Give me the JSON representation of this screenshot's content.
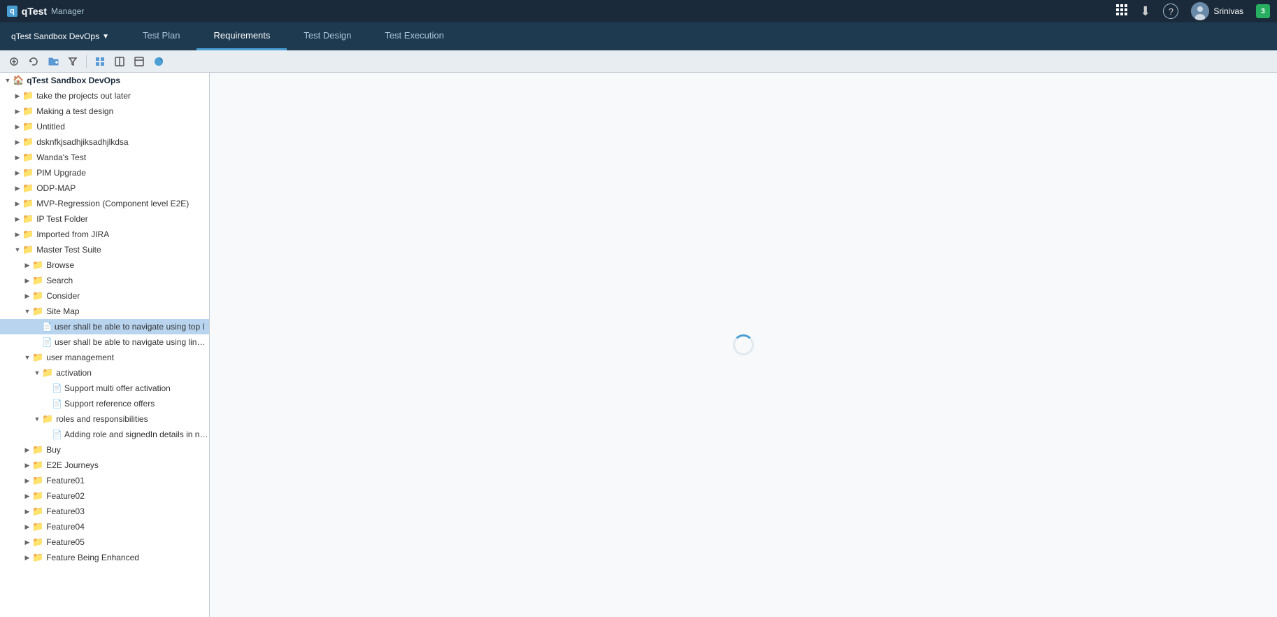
{
  "app": {
    "name": "qTest",
    "product": "Manager"
  },
  "topbar": {
    "project": "qTest Sandbox DevOps",
    "user": "Srinivas",
    "download_icon": "⬇",
    "help_icon": "?",
    "notification_count": "3"
  },
  "nav": {
    "tabs": [
      {
        "id": "test-plan",
        "label": "Test Plan",
        "active": false
      },
      {
        "id": "requirements",
        "label": "Requirements",
        "active": true
      },
      {
        "id": "test-design",
        "label": "Test Design",
        "active": false
      },
      {
        "id": "test-execution",
        "label": "Test Execution",
        "active": false
      }
    ]
  },
  "toolbar": {
    "buttons": [
      {
        "id": "expand",
        "icon": "⊞",
        "title": "Expand All"
      },
      {
        "id": "refresh",
        "icon": "↺",
        "title": "Refresh"
      },
      {
        "id": "add-folder",
        "icon": "📁",
        "title": "Add Folder"
      },
      {
        "id": "filter",
        "icon": "⊿",
        "title": "Filter"
      },
      {
        "id": "move-up",
        "icon": "▣",
        "title": "Move Up"
      },
      {
        "id": "move-down",
        "icon": "◪",
        "title": "Move Down"
      },
      {
        "id": "settings",
        "icon": "⊡",
        "title": "Settings"
      },
      {
        "id": "toggle",
        "icon": "◑",
        "title": "Toggle View"
      }
    ]
  },
  "tree": {
    "root": "qTest Sandbox DevOps",
    "items": [
      {
        "id": "root",
        "label": "qTest Sandbox DevOps",
        "type": "root",
        "indent": 0,
        "expanded": true
      },
      {
        "id": "item1",
        "label": "take the projects out later",
        "type": "folder",
        "indent": 1,
        "expanded": false
      },
      {
        "id": "item2",
        "label": "Making a test design",
        "type": "folder",
        "indent": 1,
        "expanded": false
      },
      {
        "id": "item3",
        "label": "Untitled",
        "type": "folder",
        "indent": 1,
        "expanded": false
      },
      {
        "id": "item4",
        "label": "dsknfkjsadhjiksadhjlkdsa",
        "type": "folder",
        "indent": 1,
        "expanded": false
      },
      {
        "id": "item5",
        "label": "Wanda's Test",
        "type": "folder",
        "indent": 1,
        "expanded": false
      },
      {
        "id": "item6",
        "label": "PIM Upgrade",
        "type": "folder",
        "indent": 1,
        "expanded": false
      },
      {
        "id": "item7",
        "label": "ODP-MAP",
        "type": "folder",
        "indent": 1,
        "expanded": false
      },
      {
        "id": "item8",
        "label": "MVP-Regression (Component level E2E)",
        "type": "folder",
        "indent": 1,
        "expanded": false
      },
      {
        "id": "item9",
        "label": "IP Test Folder",
        "type": "folder",
        "indent": 1,
        "expanded": false
      },
      {
        "id": "item10",
        "label": "Imported from JIRA",
        "type": "folder",
        "indent": 1,
        "expanded": false
      },
      {
        "id": "item11",
        "label": "Master Test Suite",
        "type": "folder",
        "indent": 1,
        "expanded": true
      },
      {
        "id": "item12",
        "label": "Browse",
        "type": "folder",
        "indent": 2,
        "expanded": false
      },
      {
        "id": "item13",
        "label": "Search",
        "type": "folder",
        "indent": 2,
        "expanded": false
      },
      {
        "id": "item14",
        "label": "Consider",
        "type": "folder",
        "indent": 2,
        "expanded": false
      },
      {
        "id": "item15",
        "label": "Site Map",
        "type": "folder",
        "indent": 2,
        "expanded": true
      },
      {
        "id": "item16",
        "label": "user shall be able to navigate using top l",
        "type": "doc",
        "indent": 3,
        "selected": true
      },
      {
        "id": "item17",
        "label": "user shall be able to navigate using links wi",
        "type": "doc",
        "indent": 3
      },
      {
        "id": "item18",
        "label": "user management",
        "type": "folder",
        "indent": 2,
        "expanded": true
      },
      {
        "id": "item19",
        "label": "activation",
        "type": "folder",
        "indent": 3,
        "expanded": true
      },
      {
        "id": "item20",
        "label": "Support multi offer activation",
        "type": "doc",
        "indent": 4
      },
      {
        "id": "item21",
        "label": "Support reference offers",
        "type": "doc",
        "indent": 4
      },
      {
        "id": "item22",
        "label": "roles and responsibilities",
        "type": "folder",
        "indent": 3,
        "expanded": true
      },
      {
        "id": "item23",
        "label": "Adding role and signedIn details in norm",
        "type": "doc",
        "indent": 4
      },
      {
        "id": "item24",
        "label": "Buy",
        "type": "folder",
        "indent": 2,
        "expanded": false
      },
      {
        "id": "item25",
        "label": "E2E Journeys",
        "type": "folder",
        "indent": 2,
        "expanded": false
      },
      {
        "id": "item26",
        "label": "Feature01",
        "type": "folder",
        "indent": 2,
        "expanded": false
      },
      {
        "id": "item27",
        "label": "Feature02",
        "type": "folder",
        "indent": 2,
        "expanded": false
      },
      {
        "id": "item28",
        "label": "Feature03",
        "type": "folder",
        "indent": 2,
        "expanded": false
      },
      {
        "id": "item29",
        "label": "Feature04",
        "type": "folder",
        "indent": 2,
        "expanded": false
      },
      {
        "id": "item30",
        "label": "Feature05",
        "type": "folder",
        "indent": 2,
        "expanded": false
      },
      {
        "id": "item31",
        "label": "Feature Being Enhanced",
        "type": "folder",
        "indent": 2,
        "expanded": false
      }
    ]
  }
}
